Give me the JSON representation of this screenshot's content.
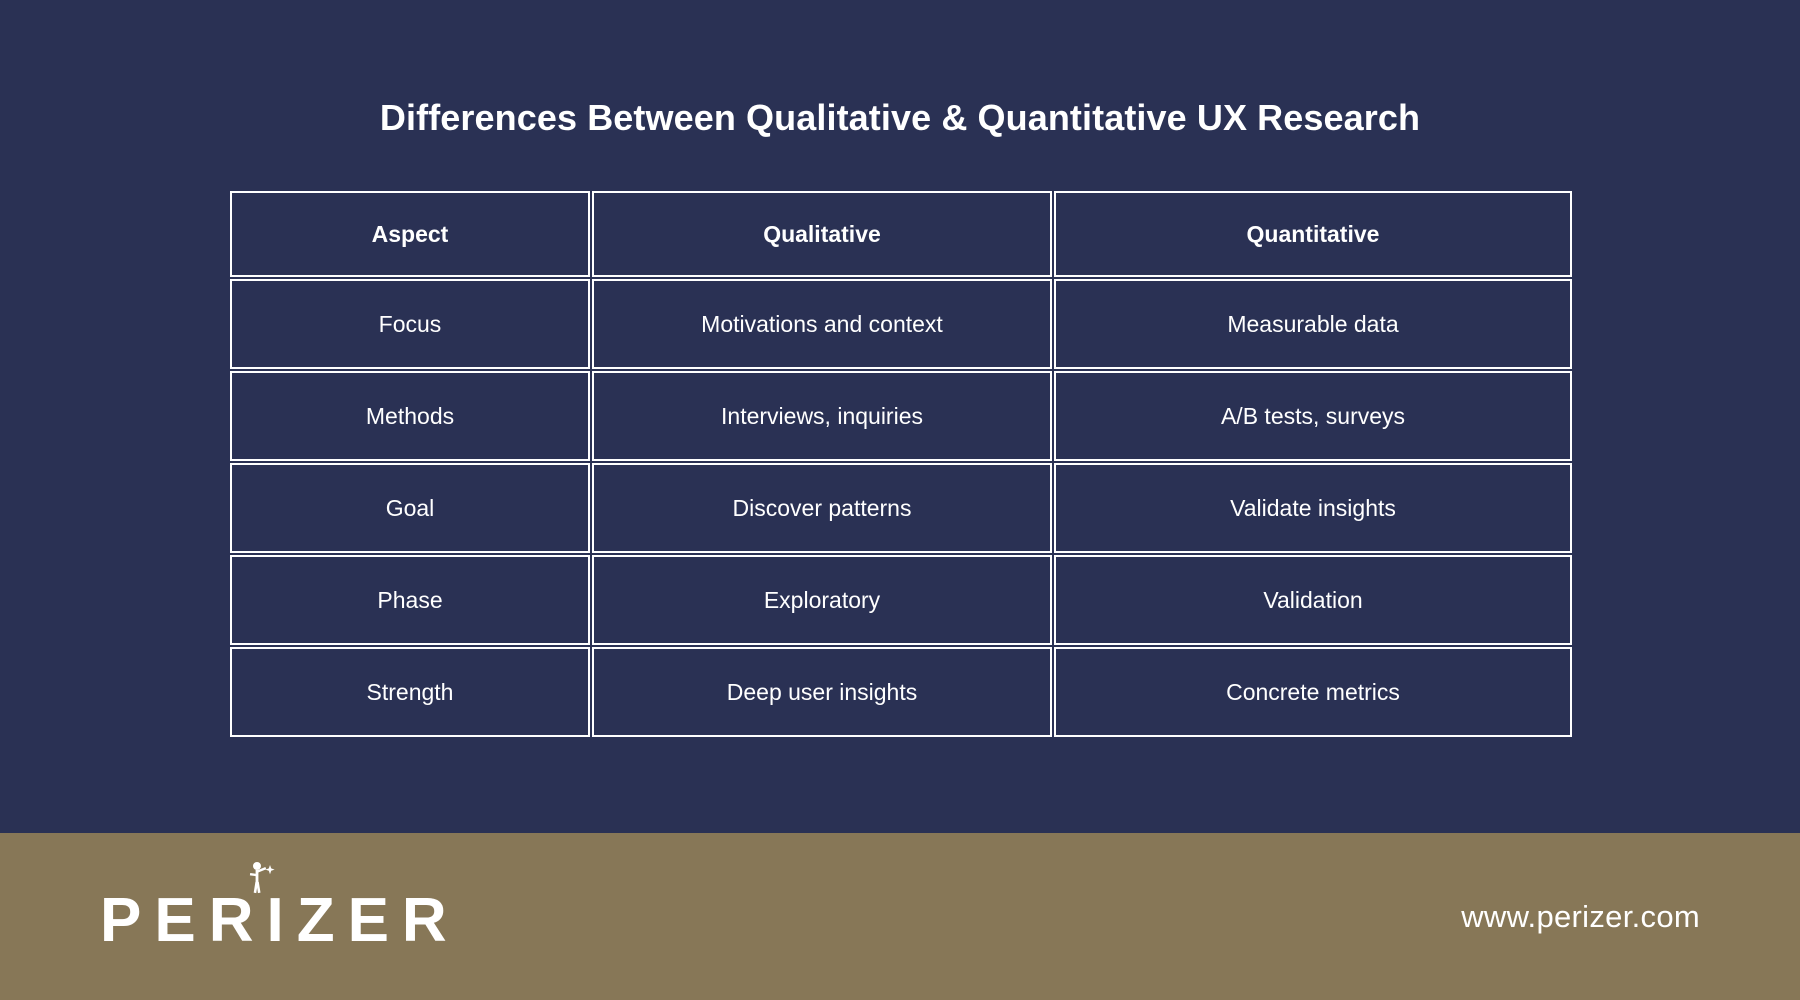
{
  "theme": {
    "background": "#2a3154",
    "footer_background": "#877757",
    "text_color": "#ffffff",
    "border_color": "#ffffff"
  },
  "header": {
    "title": "Differences Between Qualitative & Quantitative UX Research"
  },
  "table": {
    "columns": [
      "Aspect",
      "Qualitative",
      "Quantitative"
    ],
    "rows": [
      [
        "Focus",
        "Motivations and context",
        "Measurable data"
      ],
      [
        "Methods",
        "Interviews, inquiries",
        "A/B tests, surveys"
      ],
      [
        "Goal",
        "Discover patterns",
        "Validate insights"
      ],
      [
        "Phase",
        "Exploratory",
        "Validation"
      ],
      [
        "Strength",
        "Deep user insights",
        "Concrete metrics"
      ]
    ]
  },
  "footer": {
    "brand_name": "PERIZER",
    "brand_icon": "standing-figure-icon",
    "website": "www.perizer.com"
  }
}
